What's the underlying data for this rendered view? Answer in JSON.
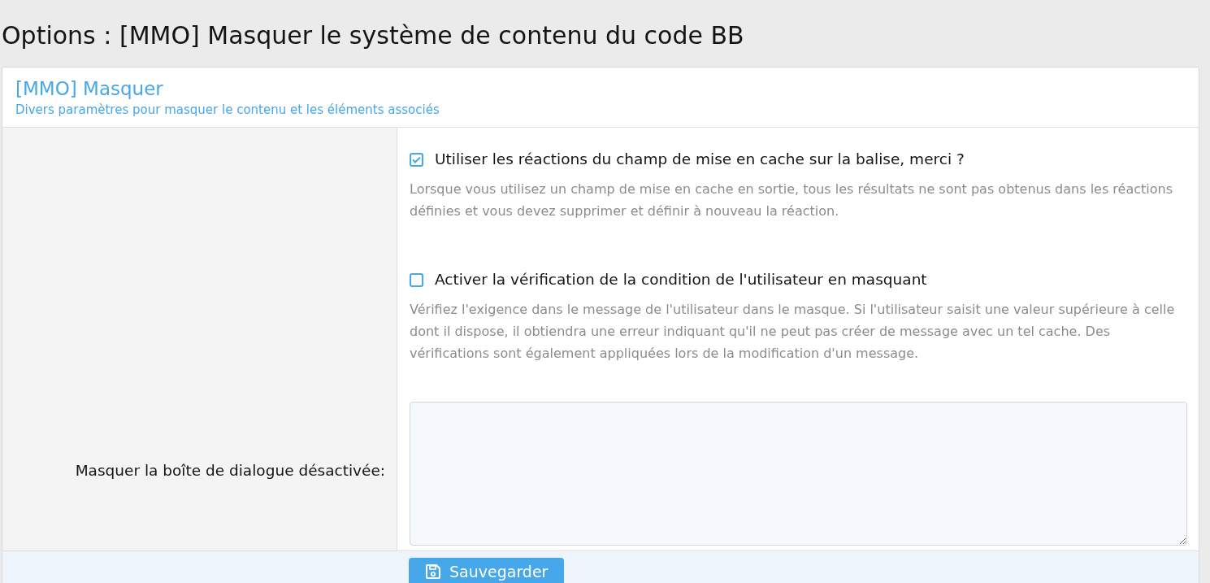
{
  "page_title": "Options : [MMO] Masquer le système de contenu du code BB",
  "block": {
    "title": "[MMO] Masquer",
    "description": "Divers paramètres pour masquer le contenu et les éléments associés"
  },
  "options": [
    {
      "kind": "checkbox",
      "label": "Utiliser les réactions du champ de mise en cache sur la balise, merci ?",
      "checked": true,
      "hint": "Lorsque vous utilisez un champ de mise en cache en sortie, tous les résultats ne sont pas obtenus dans les réactions définies et vous devez supprimer et définir à nouveau la réaction."
    },
    {
      "kind": "checkbox",
      "label": "Activer la vérification de la condition de l'utilisateur en masquant",
      "checked": false,
      "hint": "Vérifiez l'exigence dans le message de l'utilisateur dans le masque. Si l'utilisateur saisit une valeur supérieure à celle dont il dispose, il obtiendra une erreur indiquant qu'il ne peut pas créer de message avec un tel cache. Des vérifications sont également appliquées lors de la modification d'un message."
    },
    {
      "kind": "textarea",
      "label": "Masquer la boîte de dialogue désactivée:"
    }
  ],
  "save_button": {
    "label": "Sauvegarder"
  }
}
